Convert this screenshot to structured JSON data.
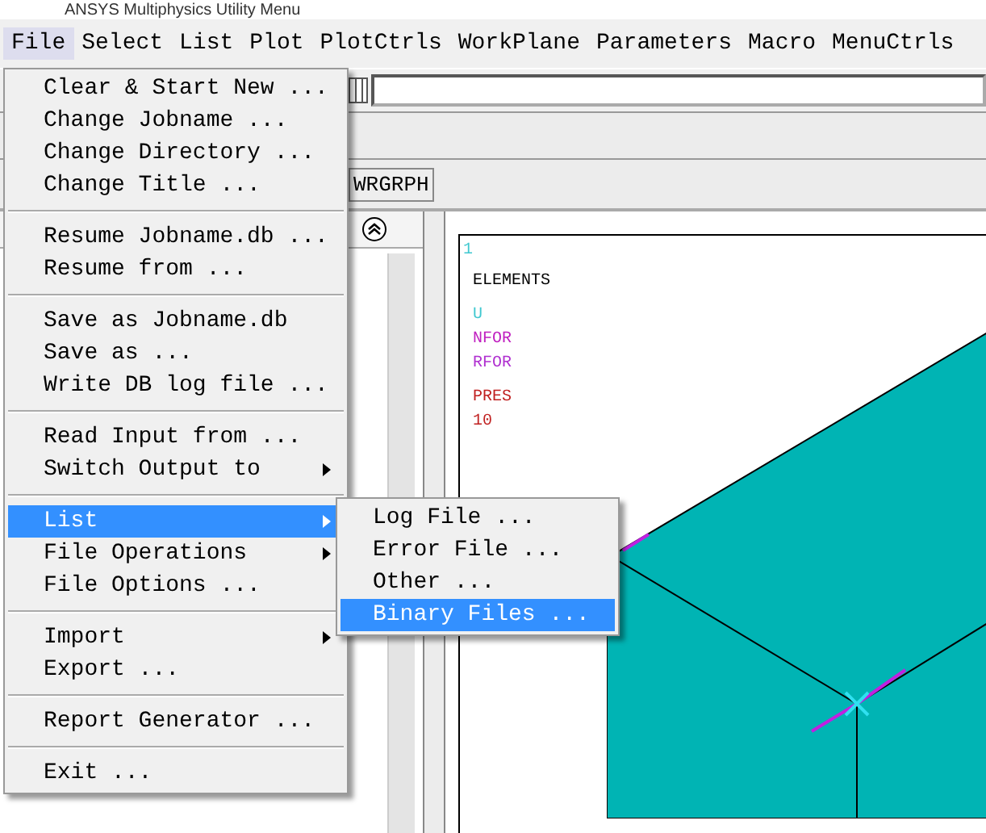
{
  "window": {
    "title": "ANSYS Multiphysics Utility Menu"
  },
  "menubar": [
    {
      "label": "File",
      "selected": true
    },
    {
      "label": "Select",
      "selected": false
    },
    {
      "label": "List",
      "selected": false
    },
    {
      "label": "Plot",
      "selected": false
    },
    {
      "label": "PlotCtrls",
      "selected": false
    },
    {
      "label": "WorkPlane",
      "selected": false
    },
    {
      "label": "Parameters",
      "selected": false
    },
    {
      "label": "Macro",
      "selected": false
    },
    {
      "label": "MenuCtrls",
      "selected": false
    }
  ],
  "toolbar": {
    "button": "WRGRPH"
  },
  "file_menu": [
    [
      {
        "label": "Clear & Start New ...",
        "selected": false,
        "submenu": false
      },
      {
        "label": "Change Jobname ...",
        "selected": false,
        "submenu": false
      },
      {
        "label": "Change Directory ...",
        "selected": false,
        "submenu": false
      },
      {
        "label": "Change Title ...",
        "selected": false,
        "submenu": false
      }
    ],
    [
      {
        "label": "Resume Jobname.db ...",
        "selected": false,
        "submenu": false
      },
      {
        "label": "Resume from ...",
        "selected": false,
        "submenu": false
      }
    ],
    [
      {
        "label": "Save as Jobname.db",
        "selected": false,
        "submenu": false
      },
      {
        "label": "Save as ...",
        "selected": false,
        "submenu": false
      },
      {
        "label": "Write DB log file ...",
        "selected": false,
        "submenu": false
      }
    ],
    [
      {
        "label": "Read Input from ...",
        "selected": false,
        "submenu": false
      },
      {
        "label": "Switch Output to",
        "selected": false,
        "submenu": true
      }
    ],
    [
      {
        "label": "List",
        "selected": true,
        "submenu": true
      },
      {
        "label": "File Operations",
        "selected": false,
        "submenu": true
      },
      {
        "label": "File Options ...",
        "selected": false,
        "submenu": false
      }
    ],
    [
      {
        "label": "Import",
        "selected": false,
        "submenu": true
      },
      {
        "label": "Export ...",
        "selected": false,
        "submenu": false
      }
    ],
    [
      {
        "label": "Report Generator ...",
        "selected": false,
        "submenu": false
      }
    ],
    [
      {
        "label": "Exit ...",
        "selected": false,
        "submenu": false
      }
    ]
  ],
  "list_submenu": [
    {
      "label": "Log File ...",
      "selected": false
    },
    {
      "label": "Error File ...",
      "selected": false
    },
    {
      "label": "Other ...",
      "selected": false
    },
    {
      "label": "Binary Files ...",
      "selected": true
    }
  ],
  "graphics": {
    "window_number": "1",
    "legend": [
      [
        {
          "text": "ELEMENTS",
          "color": "#000000"
        }
      ],
      [
        {
          "text": "U",
          "color": "#40c8d0"
        },
        {
          "text": "NFOR",
          "color": "#c020c0"
        },
        {
          "text": "RFOR",
          "color": "#b030d0"
        }
      ],
      [
        {
          "text": "PRES",
          "color": "#c02020"
        },
        {
          "text": "10",
          "color": "#c02020"
        }
      ]
    ]
  }
}
